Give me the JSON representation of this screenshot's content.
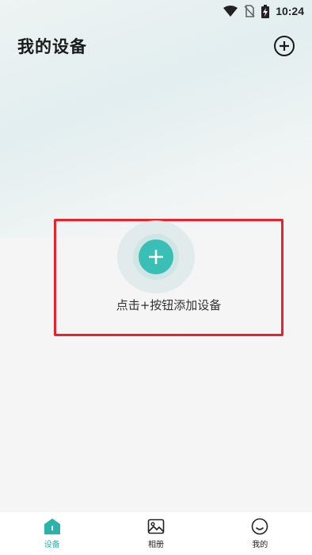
{
  "status_bar": {
    "time": "10:24",
    "icons": [
      "wifi-icon",
      "no-sim-icon",
      "battery-charging-icon"
    ]
  },
  "header": {
    "title": "我的设备",
    "add_icon": "plus-circle-icon"
  },
  "empty_state": {
    "add_icon": "plus-icon",
    "hint": "点击+按钮添加设备"
  },
  "colors": {
    "accent": "#39bfb6",
    "highlight_border": "#e8232b",
    "active_tab": "#2bb3aa"
  },
  "tabbar": {
    "tabs": [
      {
        "label": "设备",
        "icon": "home-icon",
        "active": true
      },
      {
        "label": "相册",
        "icon": "image-icon",
        "active": false
      },
      {
        "label": "我的",
        "icon": "smile-icon",
        "active": false
      }
    ]
  }
}
